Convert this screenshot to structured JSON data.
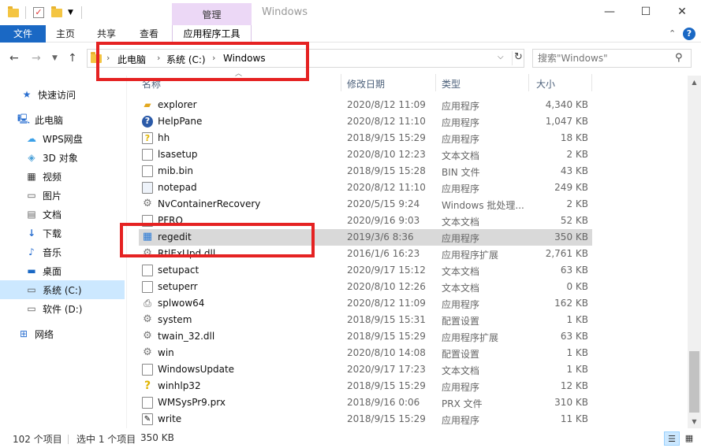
{
  "window": {
    "title": "Windows",
    "context_tab": "管理",
    "min_glyph": "—",
    "max_glyph": "☐",
    "close_glyph": "✕"
  },
  "ribbon": {
    "tabs": [
      "文件",
      "主页",
      "共享",
      "查看",
      "应用程序工具"
    ],
    "collapse_glyph": "⌃",
    "help_glyph": "?"
  },
  "address": {
    "crumbs": [
      "此电脑",
      "系统 (C:)",
      "Windows"
    ]
  },
  "search": {
    "placeholder": "搜索\"Windows\""
  },
  "sidebar": {
    "items": [
      {
        "label": "快速访问",
        "icon": "star-icon"
      },
      {
        "label": "此电脑",
        "icon": "computer-icon"
      },
      {
        "label": "WPS网盘",
        "icon": "cloud-icon"
      },
      {
        "label": "3D 对象",
        "icon": "cube-icon"
      },
      {
        "label": "视频",
        "icon": "video-icon"
      },
      {
        "label": "图片",
        "icon": "picture-icon"
      },
      {
        "label": "文档",
        "icon": "document-icon"
      },
      {
        "label": "下载",
        "icon": "download-icon"
      },
      {
        "label": "音乐",
        "icon": "music-icon"
      },
      {
        "label": "桌面",
        "icon": "desktop-icon"
      },
      {
        "label": "系统 (C:)",
        "icon": "drive-c-icon"
      },
      {
        "label": "软件 (D:)",
        "icon": "drive-d-icon"
      },
      {
        "label": "网络",
        "icon": "network-icon"
      }
    ]
  },
  "columns": {
    "name": "名称",
    "date": "修改日期",
    "type": "类型",
    "size": "大小"
  },
  "files": [
    {
      "name": "explorer",
      "date": "2020/8/12 11:09",
      "type": "应用程序",
      "size": "4,340 KB",
      "icon": "folder-app-icon"
    },
    {
      "name": "HelpPane",
      "date": "2020/8/12 11:10",
      "type": "应用程序",
      "size": "1,047 KB",
      "icon": "help-icon"
    },
    {
      "name": "hh",
      "date": "2018/9/15 15:29",
      "type": "应用程序",
      "size": "18 KB",
      "icon": "help-file-icon"
    },
    {
      "name": "lsasetup",
      "date": "2020/8/10 12:23",
      "type": "文本文档",
      "size": "2 KB",
      "icon": "text-file-icon"
    },
    {
      "name": "mib.bin",
      "date": "2018/9/15 15:28",
      "type": "BIN 文件",
      "size": "43 KB",
      "icon": "file-icon"
    },
    {
      "name": "notepad",
      "date": "2020/8/12 11:10",
      "type": "应用程序",
      "size": "249 KB",
      "icon": "notepad-icon"
    },
    {
      "name": "NvContainerRecovery",
      "date": "2020/5/15 9:24",
      "type": "Windows 批处理...",
      "size": "2 KB",
      "icon": "gear-icon"
    },
    {
      "name": "PFRO",
      "date": "2020/9/16 9:03",
      "type": "文本文档",
      "size": "52 KB",
      "icon": "text-file-icon"
    },
    {
      "name": "regedit",
      "date": "2019/3/6 8:36",
      "type": "应用程序",
      "size": "350 KB",
      "icon": "registry-icon",
      "selected": true
    },
    {
      "name": "RtlExUpd.dll",
      "date": "2016/1/6 16:23",
      "type": "应用程序扩展",
      "size": "2,761 KB",
      "icon": "dll-icon"
    },
    {
      "name": "setupact",
      "date": "2020/9/17 15:12",
      "type": "文本文档",
      "size": "63 KB",
      "icon": "text-file-icon"
    },
    {
      "name": "setuperr",
      "date": "2020/8/10 12:26",
      "type": "文本文档",
      "size": "0 KB",
      "icon": "text-file-icon"
    },
    {
      "name": "splwow64",
      "date": "2020/8/12 11:09",
      "type": "应用程序",
      "size": "162 KB",
      "icon": "printer-icon"
    },
    {
      "name": "system",
      "date": "2018/9/15 15:31",
      "type": "配置设置",
      "size": "1 KB",
      "icon": "config-icon"
    },
    {
      "name": "twain_32.dll",
      "date": "2018/9/15 15:29",
      "type": "应用程序扩展",
      "size": "63 KB",
      "icon": "dll-icon"
    },
    {
      "name": "win",
      "date": "2020/8/10 14:08",
      "type": "配置设置",
      "size": "1 KB",
      "icon": "config-icon"
    },
    {
      "name": "WindowsUpdate",
      "date": "2020/9/17 17:23",
      "type": "文本文档",
      "size": "1 KB",
      "icon": "text-file-icon"
    },
    {
      "name": "winhlp32",
      "date": "2018/9/15 15:29",
      "type": "应用程序",
      "size": "12 KB",
      "icon": "question-icon"
    },
    {
      "name": "WMSysPr9.prx",
      "date": "2018/9/16 0:06",
      "type": "PRX 文件",
      "size": "310 KB",
      "icon": "file-icon"
    },
    {
      "name": "write",
      "date": "2018/9/15 15:29",
      "type": "应用程序",
      "size": "11 KB",
      "icon": "write-icon"
    }
  ],
  "status": {
    "count": "102 个项目",
    "selected": "选中 1 个项目",
    "size": "350 KB"
  },
  "colors": {
    "accent": "#1a68c4",
    "selection": "#cce8ff",
    "row_selected": "#d9d9d9",
    "highlight_box": "#e52222",
    "manage_tab": "#ecd8f6"
  }
}
